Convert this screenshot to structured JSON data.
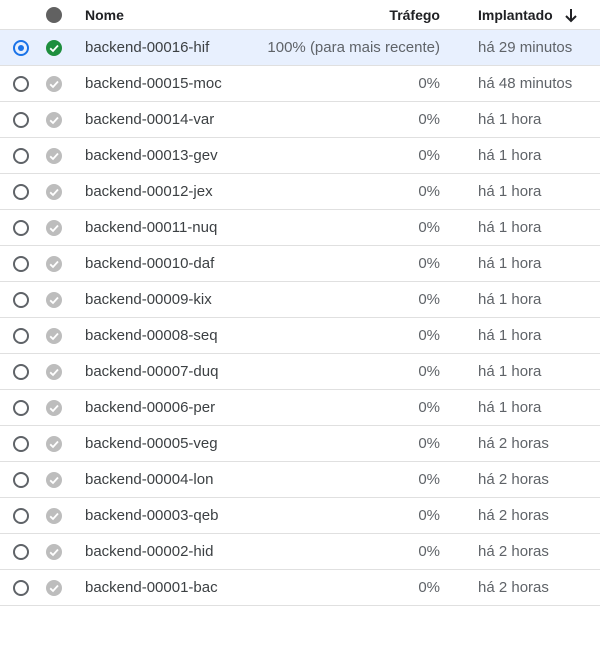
{
  "colors": {
    "accent": "#1a73e8",
    "active_check": "#1e8e3e",
    "inactive_check": "#bdbdbd",
    "selected_row_bg": "#e8f0fe"
  },
  "header": {
    "name_label": "Nome",
    "traffic_label": "Tráfego",
    "deployed_label": "Implantado",
    "status_icon": "status-dot-icon",
    "sort_icon": "arrow-down-icon"
  },
  "revisions": [
    {
      "name": "backend-00016-hif",
      "traffic": "100% (para mais recente)",
      "deployed": "há 29 minutos",
      "selected": true,
      "active": true
    },
    {
      "name": "backend-00015-moc",
      "traffic": "0%",
      "deployed": "há 48 minutos",
      "selected": false,
      "active": false
    },
    {
      "name": "backend-00014-var",
      "traffic": "0%",
      "deployed": "há 1 hora",
      "selected": false,
      "active": false
    },
    {
      "name": "backend-00013-gev",
      "traffic": "0%",
      "deployed": "há 1 hora",
      "selected": false,
      "active": false
    },
    {
      "name": "backend-00012-jex",
      "traffic": "0%",
      "deployed": "há 1 hora",
      "selected": false,
      "active": false
    },
    {
      "name": "backend-00011-nuq",
      "traffic": "0%",
      "deployed": "há 1 hora",
      "selected": false,
      "active": false
    },
    {
      "name": "backend-00010-daf",
      "traffic": "0%",
      "deployed": "há 1 hora",
      "selected": false,
      "active": false
    },
    {
      "name": "backend-00009-kix",
      "traffic": "0%",
      "deployed": "há 1 hora",
      "selected": false,
      "active": false
    },
    {
      "name": "backend-00008-seq",
      "traffic": "0%",
      "deployed": "há 1 hora",
      "selected": false,
      "active": false
    },
    {
      "name": "backend-00007-duq",
      "traffic": "0%",
      "deployed": "há 1 hora",
      "selected": false,
      "active": false
    },
    {
      "name": "backend-00006-per",
      "traffic": "0%",
      "deployed": "há 1 hora",
      "selected": false,
      "active": false
    },
    {
      "name": "backend-00005-veg",
      "traffic": "0%",
      "deployed": "há 2 horas",
      "selected": false,
      "active": false
    },
    {
      "name": "backend-00004-lon",
      "traffic": "0%",
      "deployed": "há 2 horas",
      "selected": false,
      "active": false
    },
    {
      "name": "backend-00003-qeb",
      "traffic": "0%",
      "deployed": "há 2 horas",
      "selected": false,
      "active": false
    },
    {
      "name": "backend-00002-hid",
      "traffic": "0%",
      "deployed": "há 2 horas",
      "selected": false,
      "active": false
    },
    {
      "name": "backend-00001-bac",
      "traffic": "0%",
      "deployed": "há 2 horas",
      "selected": false,
      "active": false
    }
  ]
}
